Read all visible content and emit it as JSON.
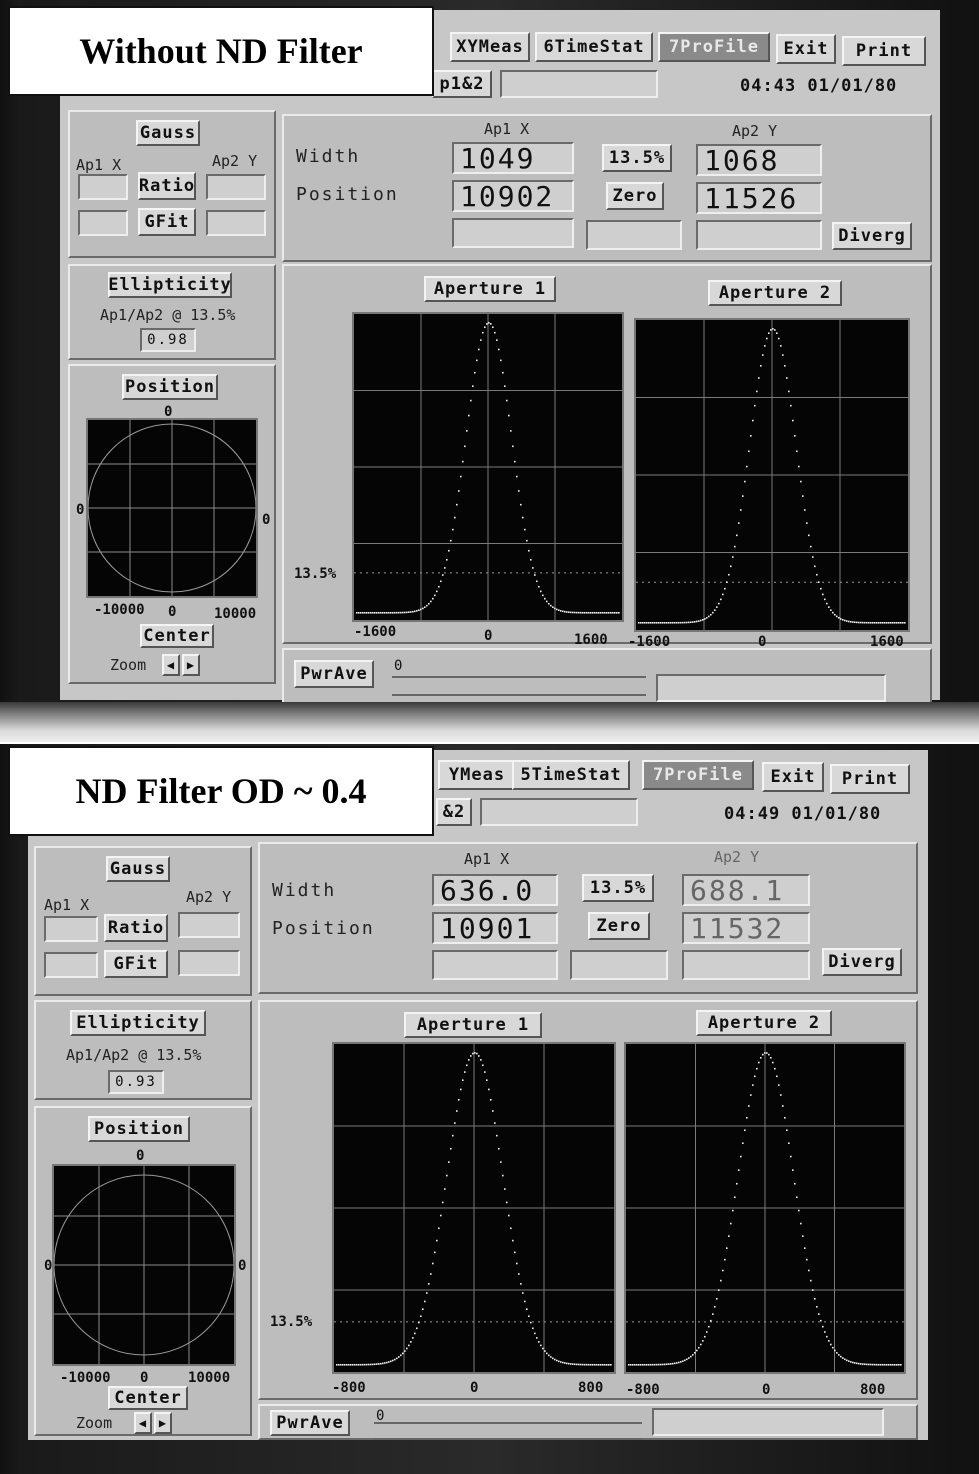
{
  "screens": [
    {
      "caption": "Without ND Filter",
      "menu": {
        "xymeas": "XYMeas",
        "timestat": "6TimeStat",
        "profile": "7ProFile",
        "exit": "Exit",
        "print": "Print",
        "ap12": "p1&2"
      },
      "status_time": "04:43  01/01/80",
      "gauss_panel": {
        "gauss": "Gauss",
        "ap1x": "Ap1 X",
        "ap2y": "Ap2 Y",
        "ratio": "Ratio",
        "gfit": "GFit"
      },
      "measure": {
        "col_ap1": "Ap1 X",
        "col_ap2": "Ap2 Y",
        "width_label": "Width",
        "position_label": "Position",
        "width_ap1": "1049",
        "width_ap2": "1068",
        "clip_button": "13.5%",
        "position_ap1": "10902",
        "position_ap2": "11526",
        "zero_button": "Zero",
        "diverg_button": "Diverg"
      },
      "ellipticity": {
        "title": "Ellipticity",
        "sub": "Ap1/Ap2 @ 13.5%",
        "value": "0.98"
      },
      "position_panel": {
        "title": "Position",
        "top": "0",
        "left": "0",
        "right": "0",
        "xmin": "-10000",
        "xmid": "0",
        "xmax": "10000",
        "center": "Center",
        "zoom": "Zoom"
      },
      "aperture1": {
        "title": "Aperture 1",
        "clip_label": "13.5%",
        "xmin": "-1600",
        "xmid": "0",
        "xmax": "1600"
      },
      "aperture2": {
        "title": "Aperture 2",
        "xmin": "-1600",
        "xmid": "0",
        "xmax": "1600"
      },
      "power": {
        "button": "PwrAve",
        "scale0": "0"
      }
    },
    {
      "caption": "ND Filter OD ~ 0.4",
      "menu": {
        "xymeas": "YMeas",
        "timestat": "5TimeStat",
        "profile": "7ProFile",
        "exit": "Exit",
        "print": "Print",
        "ap12": "&2"
      },
      "status_time": "04:49  01/01/80",
      "gauss_panel": {
        "gauss": "Gauss",
        "ap1x": "Ap1 X",
        "ap2y": "Ap2 Y",
        "ratio": "Ratio",
        "gfit": "GFit"
      },
      "measure": {
        "col_ap1": "Ap1 X",
        "col_ap2": "Ap2 Y",
        "width_label": "Width",
        "position_label": "Position",
        "width_ap1": "636.0",
        "width_ap2": "688.1",
        "clip_button": "13.5%",
        "position_ap1": "10901",
        "position_ap2": "11532",
        "zero_button": "Zero",
        "diverg_button": "Diverg"
      },
      "ellipticity": {
        "title": "Ellipticity",
        "sub": "Ap1/Ap2 @ 13.5%",
        "value": "0.93"
      },
      "position_panel": {
        "title": "Position",
        "top": "0",
        "left": "0",
        "right": "0",
        "xmin": "-10000",
        "xmid": "0",
        "xmax": "10000",
        "center": "Center",
        "zoom": "Zoom"
      },
      "aperture1": {
        "title": "Aperture 1",
        "clip_label": "13.5%",
        "xmin": "-800",
        "xmid": "0",
        "xmax": "800"
      },
      "aperture2": {
        "title": "Aperture 2",
        "xmin": "-800",
        "xmid": "0",
        "xmax": "800"
      },
      "power": {
        "button": "PwrAve",
        "scale0": "0"
      }
    }
  ]
}
